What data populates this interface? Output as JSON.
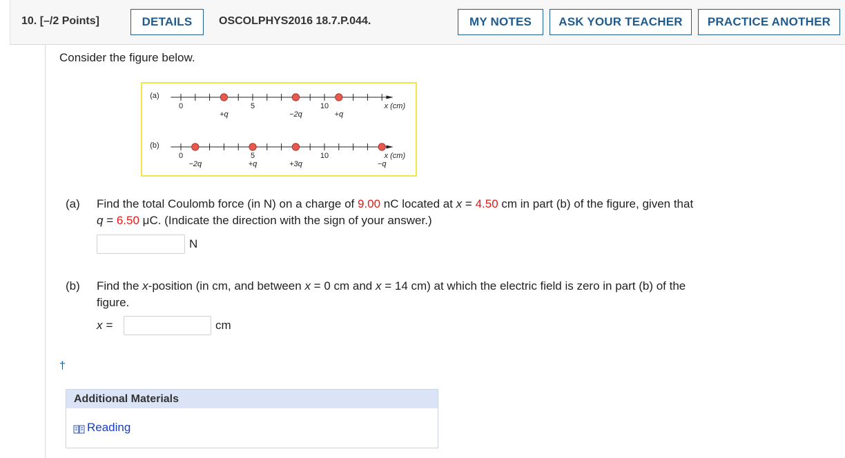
{
  "header": {
    "question_number": "10. [–/2 Points]",
    "details_label": "DETAILS",
    "assignment_code": "OSCOLPHYS2016 18.7.P.044.",
    "my_notes_label": "MY NOTES",
    "ask_teacher_label": "ASK YOUR TEACHER",
    "practice_label": "PRACTICE ANOTHER"
  },
  "question": {
    "intro": "Consider the figure below.",
    "part_a": {
      "letter": "(a)",
      "text1": "Find the total Coulomb force (in N) on a charge of ",
      "charge": "9.00",
      "text2": " nC located at ",
      "xvar": "x",
      "text3": " = ",
      "position": "4.50",
      "text4": " cm in part (b) of the figure, given that",
      "qvar": "q",
      "text5": " = ",
      "qvalue": "6.50",
      "text6": " μC. (Indicate the direction with the sign of your answer.)",
      "answer_value": "",
      "unit": "N"
    },
    "part_b": {
      "letter": "(b)",
      "text1": "Find the ",
      "xvar": "x",
      "text2": "-position (in cm, and between ",
      "text3": " = 0 cm and ",
      "text4": " = 14 cm) at which the electric field is zero in part (b) of the",
      "line2": "figure.",
      "x_label": "x =",
      "answer_value": "",
      "unit": "cm"
    }
  },
  "figure": {
    "part_a": {
      "label": "(a)",
      "axis_unit": "x (cm)",
      "tick_labels": [
        "0",
        "5",
        "10"
      ],
      "charges": [
        {
          "x": 3,
          "label": "+q"
        },
        {
          "x": 8,
          "label": "−2q"
        },
        {
          "x": 11,
          "label": "+q"
        }
      ]
    },
    "part_b": {
      "label": "(b)",
      "axis_unit": "x (cm)",
      "tick_labels": [
        "0",
        "5",
        "10"
      ],
      "charges": [
        {
          "x": 1,
          "label": "−2q"
        },
        {
          "x": 5,
          "label": "+q"
        },
        {
          "x": 8,
          "label": "+3q"
        },
        {
          "x": 14,
          "label": "−q"
        }
      ]
    },
    "charge_color": "#e85a4f"
  },
  "dagger": "†",
  "additional": {
    "title": "Additional Materials",
    "reading_label": "Reading"
  }
}
